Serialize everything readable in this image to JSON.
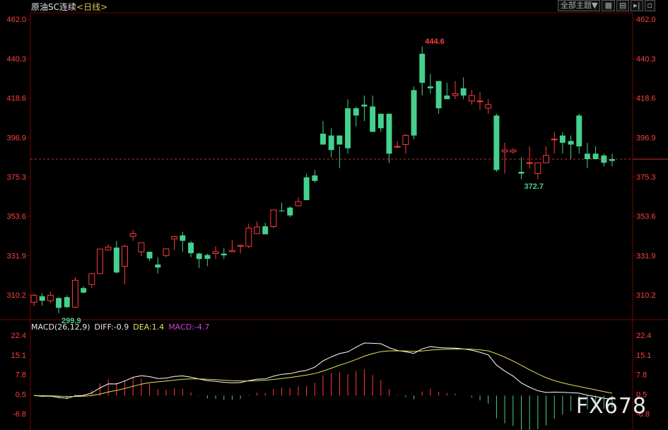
{
  "header": {
    "instrument": "原油SC连续",
    "period_open": "<",
    "period": "日线",
    "period_close": ">"
  },
  "toolbar": {
    "main_indicator": "全部主题",
    "dropdown_icon": "triangle-down",
    "buttons": [
      "grid-icon",
      "chart-icon",
      "step-forward-icon",
      "expand-icon"
    ]
  },
  "price_axis": {
    "ticks": [
      "462.0",
      "440.3",
      "418.6",
      "396.9",
      "375.3",
      "353.6",
      "331.9",
      "310.2"
    ],
    "range": [
      296.6,
      465.6
    ]
  },
  "annotations": {
    "high_label": "444.6",
    "low_label_1": "299.9",
    "low_label_2": "372.7"
  },
  "macd": {
    "title": "MACD(26,12,9)",
    "diff_label": "DIFF:-0.9",
    "dea_label": "DEA:1.4",
    "macd_label": "MACD:-4.7",
    "ticks": [
      "22.4",
      "15.1",
      "7.8",
      "0.5",
      "-6.8"
    ]
  },
  "colors": {
    "up": "#ff3a3a",
    "down": "#45d08d",
    "diff_line": "#ffffff",
    "dea_line": "#e8e05a",
    "macd_label": "#d83dd8",
    "axis_text": "#ff4040",
    "ref_line": "#ff4040"
  },
  "watermark": "FX678",
  "chart_data": {
    "type": "candlestick",
    "reference_price": 385.0,
    "candles": [
      [
        306.2,
        311.0,
        304.0,
        310.0
      ],
      [
        309.5,
        311.2,
        304.3,
        307.0
      ],
      [
        307.0,
        312.0,
        305.8,
        310.0
      ],
      [
        308.5,
        309.0,
        300.2,
        303.1
      ],
      [
        309.0,
        310.0,
        303.0,
        303.5
      ],
      [
        303.5,
        320.0,
        303.0,
        318.3
      ],
      [
        314.0,
        315.0,
        311.0,
        311.5
      ],
      [
        316.0,
        322.0,
        314.0,
        322.0
      ],
      [
        322.0,
        334.0,
        322.0,
        335.5
      ],
      [
        335.0,
        338.0,
        335.0,
        336.6
      ],
      [
        336.3,
        340.0,
        322.0,
        322.6
      ],
      [
        326.0,
        338.0,
        316.0,
        337.0
      ],
      [
        342.5,
        346.0,
        340.0,
        344.0
      ],
      [
        334.0,
        338.0,
        331.5,
        339.0
      ],
      [
        334.0,
        334.0,
        329.0,
        330.3
      ],
      [
        327.0,
        331.0,
        322.0,
        325.3
      ],
      [
        331.9,
        333.0,
        331.0,
        335.6
      ],
      [
        341.0,
        342.0,
        335.0,
        342.4
      ],
      [
        343.0,
        345.0,
        334.0,
        340.0
      ],
      [
        339.0,
        340.0,
        331.0,
        333.2
      ],
      [
        333.0,
        333.5,
        325.0,
        330.0
      ],
      [
        332.2,
        333.0,
        326.0,
        330.1
      ],
      [
        333.0,
        337.0,
        330.0,
        334.0
      ],
      [
        333.0,
        336.0,
        330.0,
        332.0
      ],
      [
        334.0,
        340.5,
        334.0,
        334.7
      ],
      [
        337.0,
        338.0,
        333.0,
        337.5
      ],
      [
        337.0,
        349.5,
        336.0,
        347.0
      ],
      [
        344.0,
        350.6,
        344.0,
        347.6
      ],
      [
        348.0,
        350.0,
        345.0,
        343.6
      ],
      [
        347.8,
        357.0,
        347.0,
        357.0
      ],
      [
        356.7,
        361.0,
        356.0,
        356.5
      ],
      [
        358.3,
        359.0,
        353.0,
        354.0
      ],
      [
        359.3,
        364.0,
        359.0,
        361.6
      ],
      [
        375.0,
        377.0,
        366.0,
        362.4
      ],
      [
        376.0,
        379.0,
        372.0,
        373.0
      ],
      [
        399.0,
        406.0,
        394.0,
        393.0
      ],
      [
        398.0,
        402.0,
        386.0,
        390.0
      ],
      [
        398.0,
        392.0,
        380.0,
        393.0
      ],
      [
        413.0,
        418.0,
        388.0,
        391.0
      ],
      [
        413.0,
        414.0,
        403.0,
        409.0
      ],
      [
        415.0,
        420.0,
        406.0,
        414.0
      ],
      [
        414.0,
        420.0,
        405.0,
        400.0
      ],
      [
        410.0,
        405.0,
        400.0,
        402.0
      ],
      [
        410.0,
        410.0,
        383.0,
        388.0
      ],
      [
        392.0,
        395.0,
        391.0,
        392.0
      ],
      [
        393.0,
        399.0,
        388.0,
        398.0
      ],
      [
        423.0,
        425.0,
        396.0,
        398.0
      ],
      [
        443.0,
        447.0,
        420.0,
        427.0
      ],
      [
        425.0,
        432.0,
        421.0,
        424.0
      ],
      [
        428.0,
        427.0,
        410.0,
        413.0
      ],
      [
        420.0,
        427.0,
        418.0,
        418.0
      ],
      [
        420.0,
        428.0,
        418.0,
        421.0
      ],
      [
        424.0,
        430.0,
        418.0,
        420.0
      ],
      [
        417.0,
        423.0,
        415.0,
        420.0
      ],
      [
        417.0,
        422.0,
        412.0,
        417.0
      ],
      [
        413.0,
        418.0,
        410.0,
        415.0
      ],
      [
        409.0,
        410.0,
        378.0,
        379.0
      ],
      [
        389.0,
        394.0,
        377.0,
        390.0
      ],
      [
        389.0,
        391.0,
        388.0,
        390.0
      ],
      [
        378.0,
        386.0,
        374.0,
        377.0
      ],
      [
        383.0,
        392.0,
        380.0,
        383.0
      ],
      [
        377.0,
        382.0,
        374.0,
        383.0
      ],
      [
        383.0,
        392.0,
        383.0,
        387.0
      ],
      [
        396.0,
        400.0,
        388.0,
        396.0
      ],
      [
        398.0,
        400.0,
        388.0,
        394.0
      ],
      [
        395.0,
        398.0,
        385.0,
        393.0
      ],
      [
        409.0,
        410.0,
        388.0,
        392.0
      ],
      [
        388.0,
        394.0,
        380.0,
        385.0
      ],
      [
        388.0,
        392.0,
        385.0,
        385.0
      ],
      [
        387.0,
        388.0,
        381.0,
        383.0
      ],
      [
        385.0,
        388.0,
        381.0,
        384.0
      ]
    ]
  }
}
